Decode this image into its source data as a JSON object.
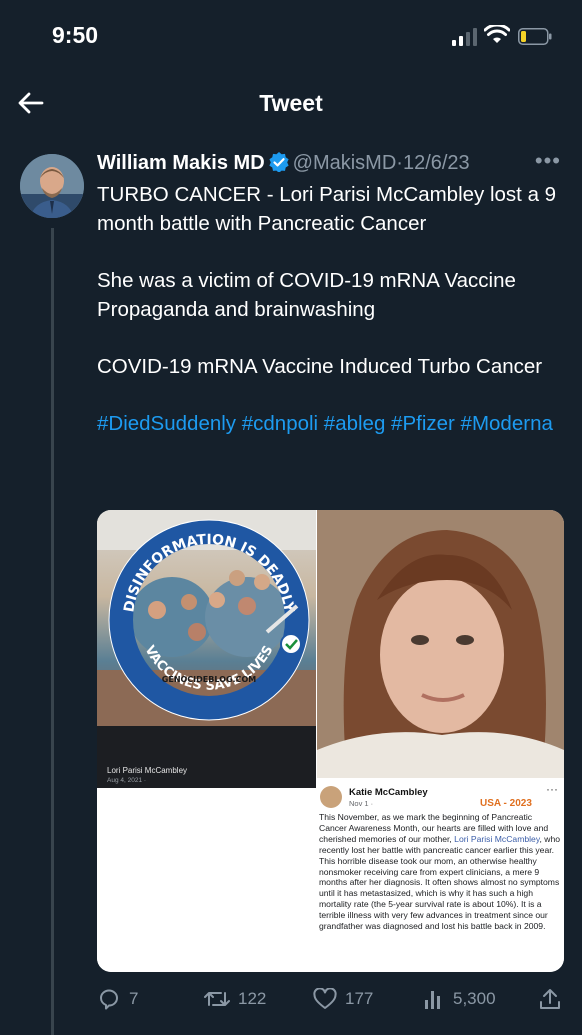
{
  "status_bar": {
    "time": "9:50"
  },
  "nav": {
    "title": "Tweet"
  },
  "tweet": {
    "author_name": "William Makis MD",
    "handle": "@MakisMD",
    "separator": "·",
    "date": "12/6/23",
    "paragraphs": [
      "TURBO CANCER - Lori Parisi McCambley lost a 9 month battle with Pancreatic Cancer",
      "She was a victim of COVID-19 mRNA Vaccine Propaganda and brainwashing",
      "COVID-19 mRNA Vaccine Induced Turbo Cancer"
    ],
    "hashtags": "#DiedSuddenly #cdnpoli #ableg #Pfizer #Moderna"
  },
  "media": {
    "badge_top": "DISINFORMATION IS DEADLY",
    "badge_bottom": "VACCINES SAVE LIVES",
    "badge_site": "GENOCIDEBLOG.COM",
    "left_caption_name": "Lori Parisi McCambley",
    "left_caption_date": "Aug 4, 2021 · ",
    "fb_name": "Katie McCambley",
    "fb_date": "Nov 1 · ",
    "fb_more": "···",
    "usa_tag": "USA - 2023",
    "fb_text_before": "This November, as we mark the beginning of Pancreatic Cancer Awareness Month, our hearts are filled with love and cherished memories of our mother, ",
    "fb_link": "Lori Parisi McCambley",
    "fb_text_after": ", who recently lost her battle with pancreatic cancer earlier this year.  This horrible disease took our mom, an otherwise healthy nonsmoker receiving care from expert clinicians, a mere 9 months after her diagnosis. It often shows almost no symptoms until it has metastasized, which is why it has such a high mortality rate (the 5-year survival rate is about 10%). It is a terrible illness with very few advances in treatment since our grandfather was diagnosed and lost his battle back in 2009."
  },
  "actions": {
    "replies": "7",
    "retweets": "122",
    "likes": "177",
    "views": "5,300"
  },
  "colors": {
    "background": "#15202b",
    "link": "#1d9bf0",
    "secondary_text": "#8b98a5",
    "verified": "#1d9bf0",
    "usa_tag": "#e07020"
  },
  "icons": [
    "back-arrow-icon",
    "verified-badge-icon",
    "more-icon",
    "reply-icon",
    "retweet-icon",
    "like-icon",
    "views-icon",
    "share-icon",
    "signal-icon",
    "wifi-icon",
    "battery-icon"
  ]
}
